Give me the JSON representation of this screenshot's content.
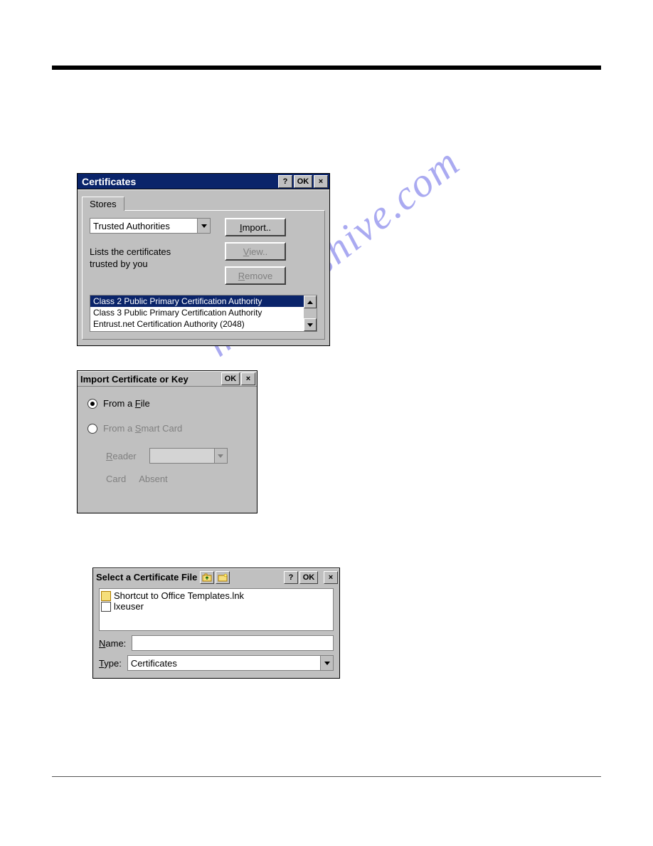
{
  "watermark": "manualshive.com",
  "dialog1": {
    "title": "Certificates",
    "help": "?",
    "ok": "OK",
    "close": "×",
    "tab": "Stores",
    "dropdown_value": "Trusted Authorities",
    "desc_line1": "Lists the certificates",
    "desc_line2": "trusted by you",
    "btn_import": "Import..",
    "btn_view": "View..",
    "btn_remove": "Remove",
    "list": [
      "Class 2 Public Primary Certification Authority",
      "Class 3 Public Primary Certification Authority",
      "Entrust.net Certification Authority (2048)"
    ]
  },
  "dialog2": {
    "title": "Import Certificate or Key",
    "ok": "OK",
    "close": "×",
    "radio_file": "From a File",
    "radio_smart": "From a Smart Card",
    "reader_label": "Reader",
    "card_label": "Card",
    "card_value": "Absent"
  },
  "dialog3": {
    "title": "Select a Certificate File",
    "help": "?",
    "ok": "OK",
    "close": "×",
    "files": [
      "Shortcut to Office Templates.lnk",
      "lxeuser"
    ],
    "name_label": "Name:",
    "type_label": "Type:",
    "type_value": "Certificates"
  }
}
